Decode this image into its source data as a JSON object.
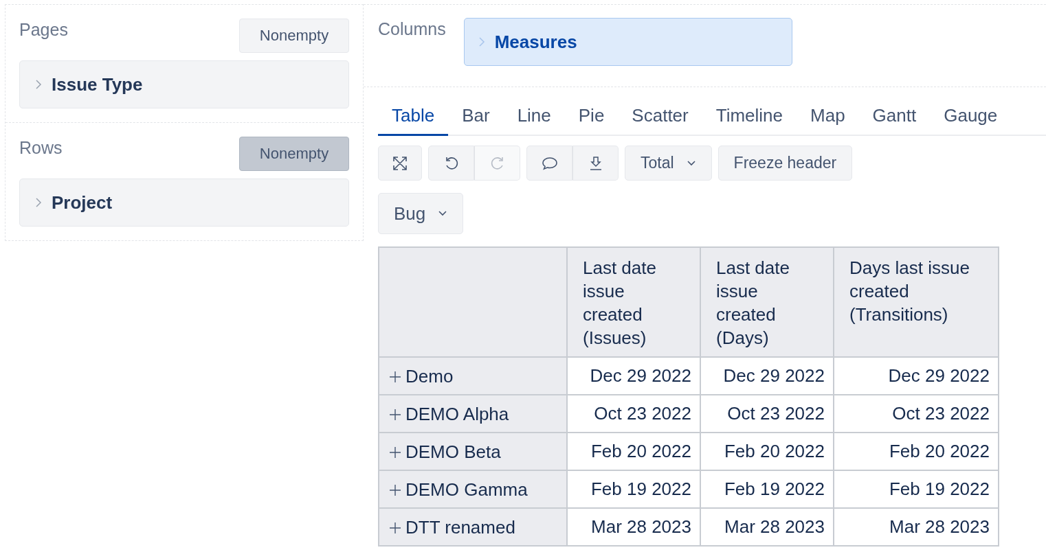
{
  "pages": {
    "label": "Pages",
    "nonempty": {
      "label": "Nonempty",
      "on": false
    },
    "items": [
      {
        "label": "Issue Type"
      }
    ]
  },
  "rows": {
    "label": "Rows",
    "nonempty": {
      "label": "Nonempty",
      "on": true
    },
    "items": [
      {
        "label": "Project"
      }
    ]
  },
  "columns": {
    "label": "Columns",
    "items": [
      {
        "label": "Measures"
      }
    ]
  },
  "tabs": [
    {
      "label": "Table",
      "selected": true
    },
    {
      "label": "Bar",
      "selected": false
    },
    {
      "label": "Line",
      "selected": false
    },
    {
      "label": "Pie",
      "selected": false
    },
    {
      "label": "Scatter",
      "selected": false
    },
    {
      "label": "Timeline",
      "selected": false
    },
    {
      "label": "Map",
      "selected": false
    },
    {
      "label": "Gantt",
      "selected": false
    },
    {
      "label": "Gauge",
      "selected": false
    }
  ],
  "toolbar": {
    "undo_disabled": false,
    "redo_disabled": true,
    "total": "Total",
    "freeze": "Freeze header",
    "page_filter": "Bug"
  },
  "table": {
    "columns": [
      "Last date issue created (Issues)",
      "Last date issue created (Days)",
      "Days last issue created (Transitions)"
    ],
    "rows": [
      {
        "label": "Demo",
        "cells": [
          "Dec 29 2022",
          "Dec 29 2022",
          "Dec 29 2022"
        ]
      },
      {
        "label": "DEMO Alpha",
        "cells": [
          "Oct 23 2022",
          "Oct 23 2022",
          "Oct 23 2022"
        ]
      },
      {
        "label": "DEMO Beta",
        "cells": [
          "Feb 20 2022",
          "Feb 20 2022",
          "Feb 20 2022"
        ]
      },
      {
        "label": "DEMO Gamma",
        "cells": [
          "Feb 19 2022",
          "Feb 19 2022",
          "Feb 19 2022"
        ]
      },
      {
        "label": "DTT renamed",
        "cells": [
          "Mar 28 2023",
          "Mar 28 2023",
          "Mar 28 2023"
        ]
      }
    ]
  }
}
